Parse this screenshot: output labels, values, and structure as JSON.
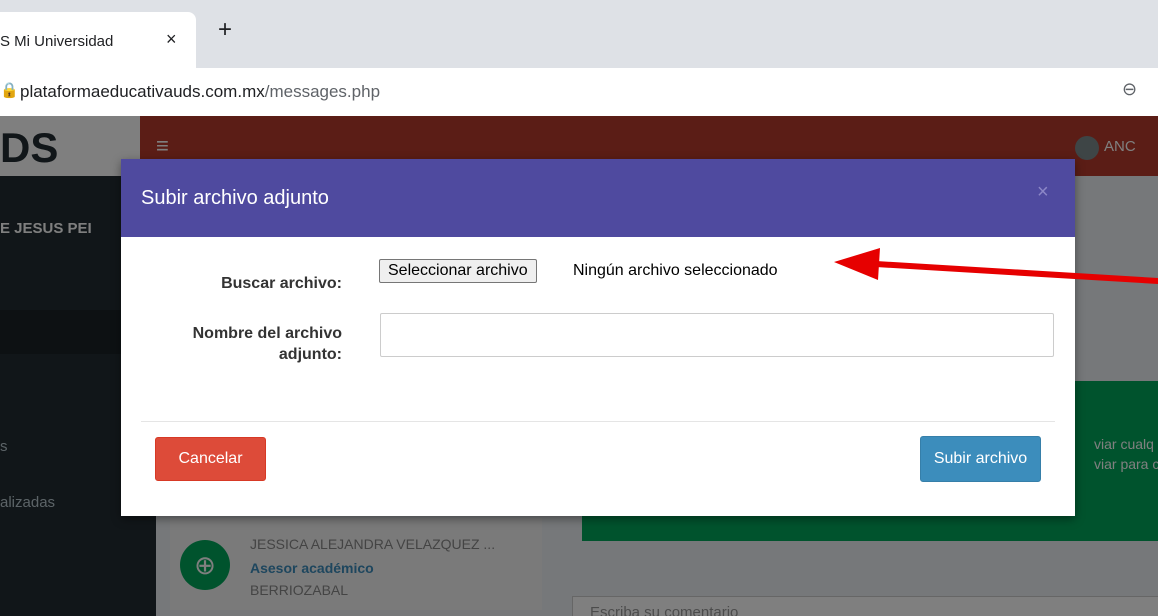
{
  "browser": {
    "tab_title": "S Mi Universidad",
    "tab_close": "×",
    "new_tab": "+",
    "url_domain": "plataformaeducativauds.com.mx",
    "url_path": "/messages.php"
  },
  "page": {
    "logo": "DS",
    "user_top": "ANC",
    "sidebar_user": "E JESUS PEI",
    "sidebar_item_1": "s",
    "sidebar_item_2": "alizadas",
    "green_text_1": "viar cualq",
    "green_text_2": "viar para c",
    "contact": {
      "name": "JESSICA ALEJANDRA VELAZQUEZ ...",
      "role": "Asesor académico",
      "place": "BERRIOZABAL"
    },
    "comment_placeholder": "Escriba su comentario"
  },
  "modal": {
    "title": "Subir archivo adjunto",
    "close": "×",
    "file_label": "Buscar archivo:",
    "file_button": "Seleccionar archivo",
    "file_status": "Ningún archivo seleccionado",
    "name_label_line1": "Nombre del archivo",
    "name_label_line2": "adjunto:",
    "name_value": "",
    "cancel_label": "Cancelar",
    "upload_label": "Subir archivo"
  },
  "colors": {
    "modal_header": "#4f4a9f",
    "cancel_button": "#dd4b39",
    "upload_button": "#3c8dbc",
    "annotation_arrow": "#e60000"
  }
}
